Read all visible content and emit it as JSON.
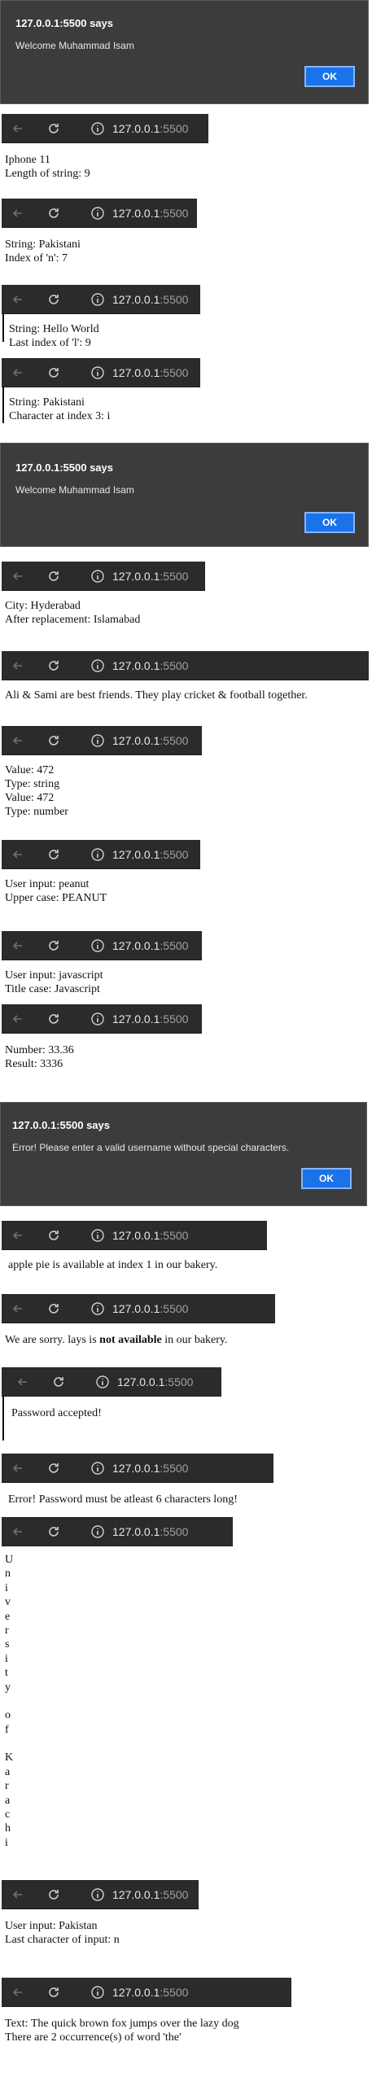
{
  "dialogs": [
    {
      "title": "127.0.0.1:5500 says",
      "message": "Welcome Muhammad Isam",
      "ok": "OK"
    },
    {
      "title": "127.0.0.1:5500 says",
      "message": "Welcome Muhammad Isam",
      "ok": "OK"
    },
    {
      "title": "127.0.0.1:5500 says",
      "message": "Error! Please enter a valid username without special characters.",
      "ok": "OK"
    }
  ],
  "address": {
    "host": "127.0.0.1",
    "port": ":5500"
  },
  "outputs": [
    {
      "lines": [
        "Iphone 11",
        "Length of string: 9"
      ]
    },
    {
      "lines": [
        "String: Pakistani",
        "Index of 'n': 7"
      ]
    },
    {
      "lines": [
        "String: Hello World",
        "Last index of 'l': 9"
      ]
    },
    {
      "lines": [
        "String: Pakistani",
        "Character at index 3: i"
      ]
    },
    {
      "lines": [
        "City: Hyderabad",
        "After replacement: Islamabad"
      ]
    },
    {
      "lines": [
        "Ali & Sami are best friends. They play cricket & football together."
      ]
    },
    {
      "lines": [
        "Value: 472",
        "Type: string",
        "Value: 472",
        "Type: number"
      ]
    },
    {
      "lines": [
        "User input: peanut",
        "Upper case: PEANUT"
      ]
    },
    {
      "lines": [
        "User input: javascript",
        "Title case: Javascript"
      ]
    },
    {
      "lines": [
        "Number: 33.36",
        "Result: 3336"
      ]
    },
    {
      "lines": [
        "apple pie is available at index 1 in our bakery."
      ]
    },
    {
      "pre": "We are sorry. lays is ",
      "bold": "not available",
      "post": " in our bakery."
    },
    {
      "lines": [
        "Password accepted!"
      ]
    },
    {
      "lines": [
        "Error! Password must be atleast 6 characters long!"
      ]
    },
    {
      "chars": [
        "U",
        "n",
        "i",
        "v",
        "e",
        "r",
        "s",
        "i",
        "t",
        "y",
        "",
        "o",
        "f",
        "",
        "K",
        "a",
        "r",
        "a",
        "c",
        "h",
        "i"
      ]
    },
    {
      "lines": [
        "User input: Pakistan",
        "Last character of input: n"
      ]
    },
    {
      "lines": [
        "Text: The quick brown fox jumps over the lazy dog",
        "There are 2 occurrence(s) of word 'the'"
      ]
    }
  ]
}
